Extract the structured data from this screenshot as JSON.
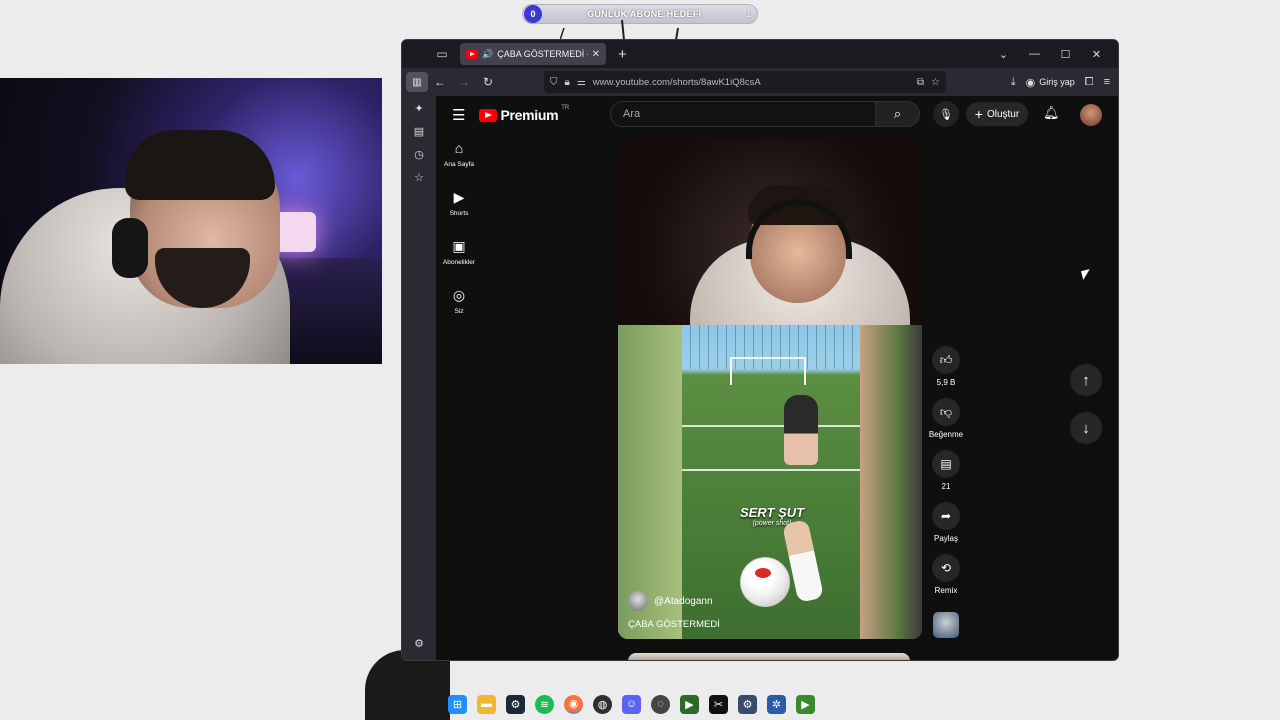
{
  "overlay": {
    "goal_count": "0",
    "goal_title": "GÜNLÜK ABONE HEDEFİ",
    "goal_target": "1"
  },
  "browser": {
    "tab_title": "ÇABA GÖSTERMEDİ - YouTube",
    "url": "www.youtube.com/shorts/8awK1iQ8csA",
    "login_label": "Giriş yap",
    "icons": [
      "sidebar-icon",
      "back-icon",
      "forward-icon",
      "reload-icon",
      "shield-icon",
      "lock-icon",
      "permissions-icon",
      "pip-icon",
      "bookmark-star-icon",
      "download-icon",
      "account-icon",
      "extensions-icon",
      "menu-icon"
    ]
  },
  "youtube": {
    "logo_text": "Premium",
    "logo_region": "TR",
    "search_placeholder": "Ara",
    "create_label": "Oluştur",
    "guide": [
      {
        "label": "Ana Sayfa",
        "icon": "home-icon"
      },
      {
        "label": "Shorts",
        "icon": "shorts-icon"
      },
      {
        "label": "Abonelikler",
        "icon": "subscriptions-icon"
      },
      {
        "label": "Siz",
        "icon": "you-icon"
      }
    ],
    "short": {
      "overlay_text": "SERT ŞUT",
      "overlay_subtext": "(power shot)",
      "channel": "@Atadogann",
      "title": "ÇABA GÖSTERMEDİ"
    },
    "actions": {
      "like_count": "5,9 B",
      "dislike_label": "Beğenme",
      "comment_count": "21",
      "share_label": "Paylaş",
      "remix_label": "Remix"
    }
  },
  "taskbar": {
    "apps": [
      "windows-start",
      "file-explorer",
      "steam",
      "spotify",
      "firefox",
      "obs",
      "discord",
      "app-circle",
      "nvidia",
      "capcut",
      "settings",
      "gear-app",
      "nvidia-2"
    ]
  },
  "colors": {
    "youtube_red": "#ff0000",
    "browser_dark": "#2b2a33",
    "yt_background": "#0f0f0f"
  }
}
